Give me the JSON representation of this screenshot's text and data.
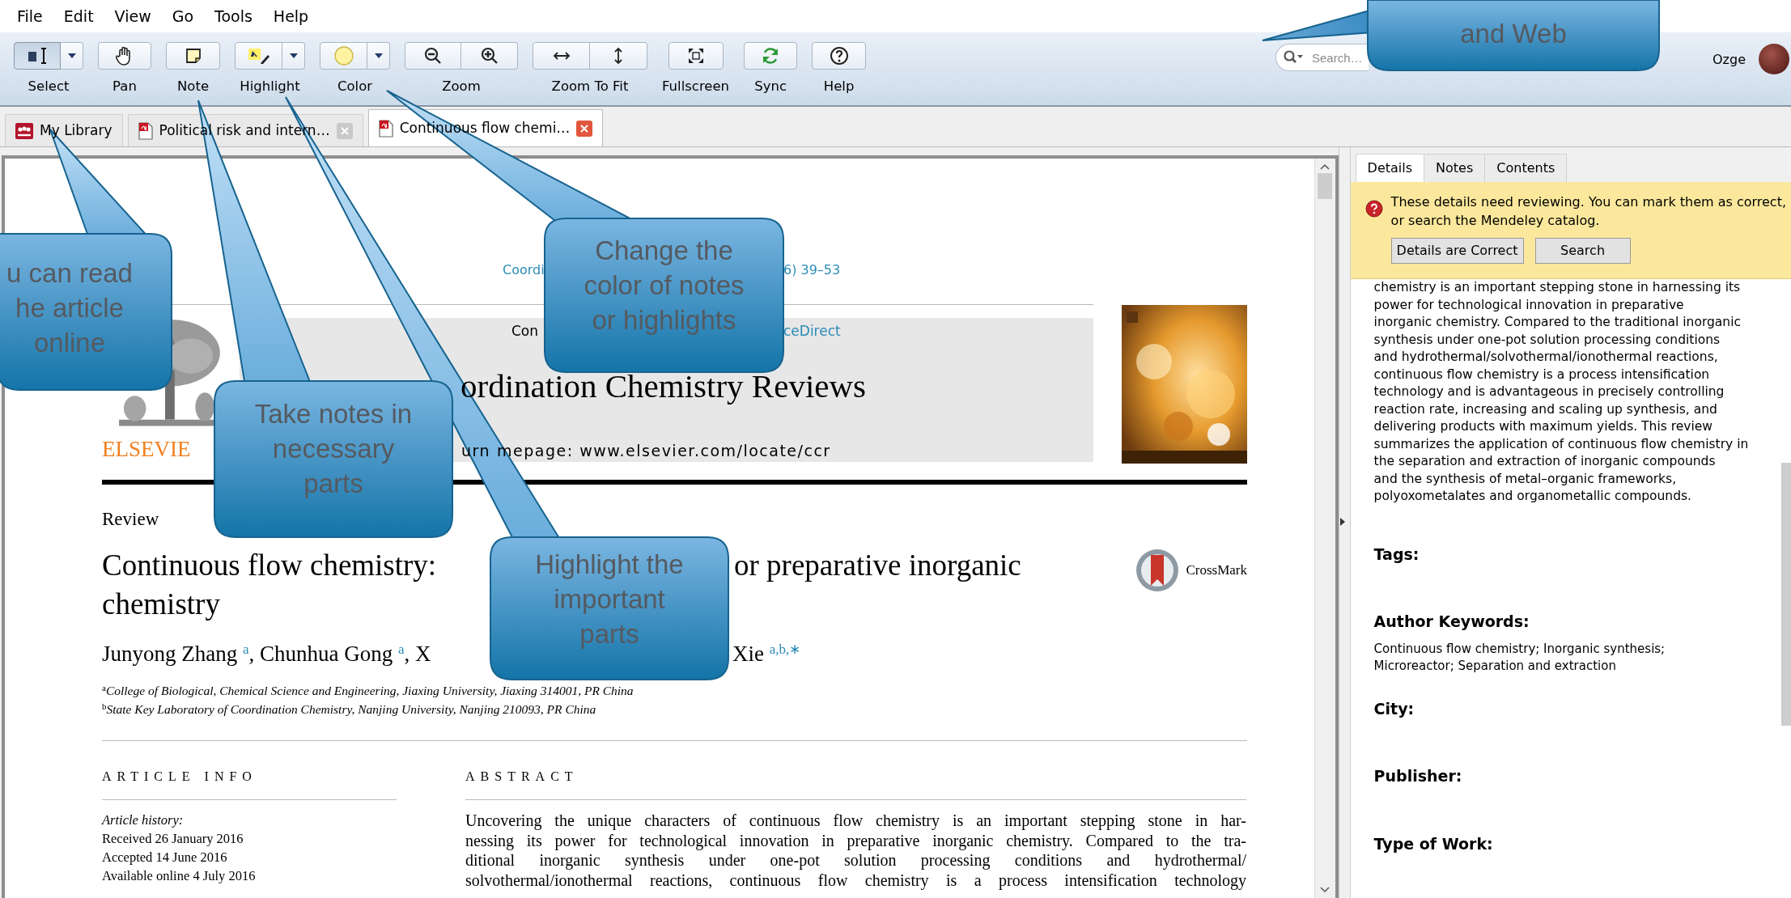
{
  "menu": [
    {
      "label": "File"
    },
    {
      "label": "Edit"
    },
    {
      "label": "View"
    },
    {
      "label": "Go"
    },
    {
      "label": "Tools"
    },
    {
      "label": "Help"
    }
  ],
  "toolbar": {
    "tools": [
      {
        "label": "Select",
        "kind": "split",
        "selected": true
      },
      {
        "label": "Pan",
        "kind": "single",
        "selected": false
      },
      {
        "label": "Note",
        "kind": "single",
        "selected": false
      },
      {
        "label": "Highlight",
        "kind": "split",
        "selected": false
      },
      {
        "label": "Color",
        "kind": "split",
        "selected": false
      },
      {
        "label": "Zoom",
        "kind": "pair",
        "selected": false
      },
      {
        "label": "Zoom To Fit",
        "kind": "pair",
        "selected": false
      },
      {
        "label": "Fullscreen",
        "kind": "single",
        "selected": false
      },
      {
        "label": "Sync",
        "kind": "single",
        "selected": false
      },
      {
        "label": "Help",
        "kind": "single",
        "selected": false
      }
    ],
    "search": {
      "placeholder": "Search…"
    },
    "user": {
      "name": "Ozge"
    }
  },
  "doc_tabs": [
    {
      "label": "My Library",
      "kind": "library",
      "selected": false
    },
    {
      "label": "Political risk and intern…",
      "kind": "pdf",
      "selected": false
    },
    {
      "label": "Continuous flow chemi…",
      "kind": "pdf",
      "selected": true
    }
  ],
  "document": {
    "journal_ref": [
      "Coordi",
      "6) 39–53"
    ],
    "masthead": {
      "sciencedirect": [
        "Con",
        "ceDirect"
      ],
      "journal_name": "ordination Chemistry Reviews",
      "homepage": [
        "urn",
        "mepage: www.elsevier.com/locate/ccr"
      ],
      "publisher": "ELSEVIE"
    },
    "article_type": "Review",
    "title_lines": [
      [
        "Continuous flow chemistry:",
        "or preparative inorganic"
      ],
      [
        "chemistry"
      ]
    ],
    "authors": [
      "Junyong Zhang $^{a}$, Chunhua Gong $^{a}$, X",
      "Xie $^{a,b,∗}$"
    ],
    "crossmark": "CrossMark",
    "affiliations": [
      "$^{a}$College of Biological, Chemical Science and Engineering, Jiaxing University, Jiaxing 314001, PR China",
      "$^{b}$State Key Laboratory of Coordination Chemistry, Nanjing University, Nanjing 210093, PR China"
    ],
    "article_info": {
      "heading": "ARTICLE INFO",
      "history_label": "Article history:",
      "history": [
        "Received 26 January 2016",
        "Accepted 14 June 2016",
        "Available online 4 July 2016"
      ]
    },
    "abstract": {
      "heading": "ABSTRACT",
      "lines": [
        "Uncovering the unique characters of continuous flow chemistry is an important stepping stone in har-",
        "nessing its power for technological innovation in preparative inorganic chemistry. Compared to the tra-",
        "ditional inorganic synthesis under one-pot solution processing conditions and hydrothermal/",
        "solvothermal/ionothermal reactions, continuous flow chemistry is a process intensification technology"
      ]
    }
  },
  "details_panel": {
    "tabs": [
      {
        "label": "Details",
        "selected": true
      },
      {
        "label": "Notes",
        "selected": false
      },
      {
        "label": "Contents",
        "selected": false
      }
    ],
    "notice": {
      "text_lines": [
        "These details need reviewing. You can mark them as correct,",
        "or search the Mendeley catalog."
      ],
      "buttons": [
        "Details are Correct",
        "Search"
      ]
    },
    "abstract_lines": [
      "chemistry is an important stepping stone in harnessing its",
      "power for technological innovation in preparative",
      "inorganic chemistry. Compared to the traditional inorganic",
      "synthesis under one-pot solution processing conditions",
      "and hydrothermal/solvothermal/ionothermal reactions,",
      "continuous flow chemistry is a process intensification",
      "technology and is advantageous in precisely controlling",
      "reaction rate, increasing and scaling up synthesis, and",
      "delivering products with maximum yields. This review",
      "summarizes the application of continuous flow chemistry in",
      "the separation and extraction of inorganic compounds",
      "and the synthesis of metal–organic frameworks,",
      "polyoxometalates and organometallic compounds."
    ],
    "fields": [
      {
        "label": "Tags:"
      },
      {
        "label": "Author Keywords:",
        "lines": [
          "Continuous flow chemistry; Inorganic synthesis;",
          "Microreactor; Separation and extraction"
        ]
      },
      {
        "label": "City:"
      },
      {
        "label": "Publisher:"
      },
      {
        "label": "Type of Work:"
      }
    ]
  },
  "callouts": [
    {
      "lines": [
        "u can read",
        "he article",
        "online"
      ]
    },
    {
      "lines": [
        "Change the",
        "color of notes",
        "or highlights"
      ]
    },
    {
      "lines": [
        "Take notes in",
        "necessary",
        "parts"
      ]
    },
    {
      "lines": [
        "Highlight the",
        "important",
        "parts"
      ]
    },
    {
      "lines": [
        "and Web"
      ]
    }
  ]
}
